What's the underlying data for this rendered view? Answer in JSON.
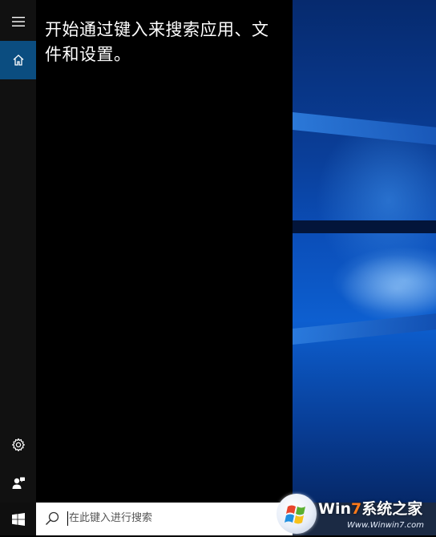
{
  "start_menu": {
    "rail": {
      "menu_icon": "hamburger-icon",
      "home_icon": "home-icon",
      "settings_icon": "gear-icon",
      "feedback_icon": "feedback-person-icon"
    },
    "prompt_text": "开始通过键入来搜索应用、文件和设置。"
  },
  "taskbar": {
    "start_icon": "windows-logo-icon",
    "search": {
      "icon": "search-icon",
      "placeholder": "在此键入进行搜索"
    }
  },
  "watermark": {
    "brand_prefix": "Win",
    "brand_seven": "7",
    "brand_suffix": "系统之家",
    "url": "Www.Winwin7.com"
  },
  "colors": {
    "rail_background": "#111111",
    "home_highlight": "#0b4d80",
    "panel_background": "#000000",
    "search_background": "#ffffff"
  }
}
